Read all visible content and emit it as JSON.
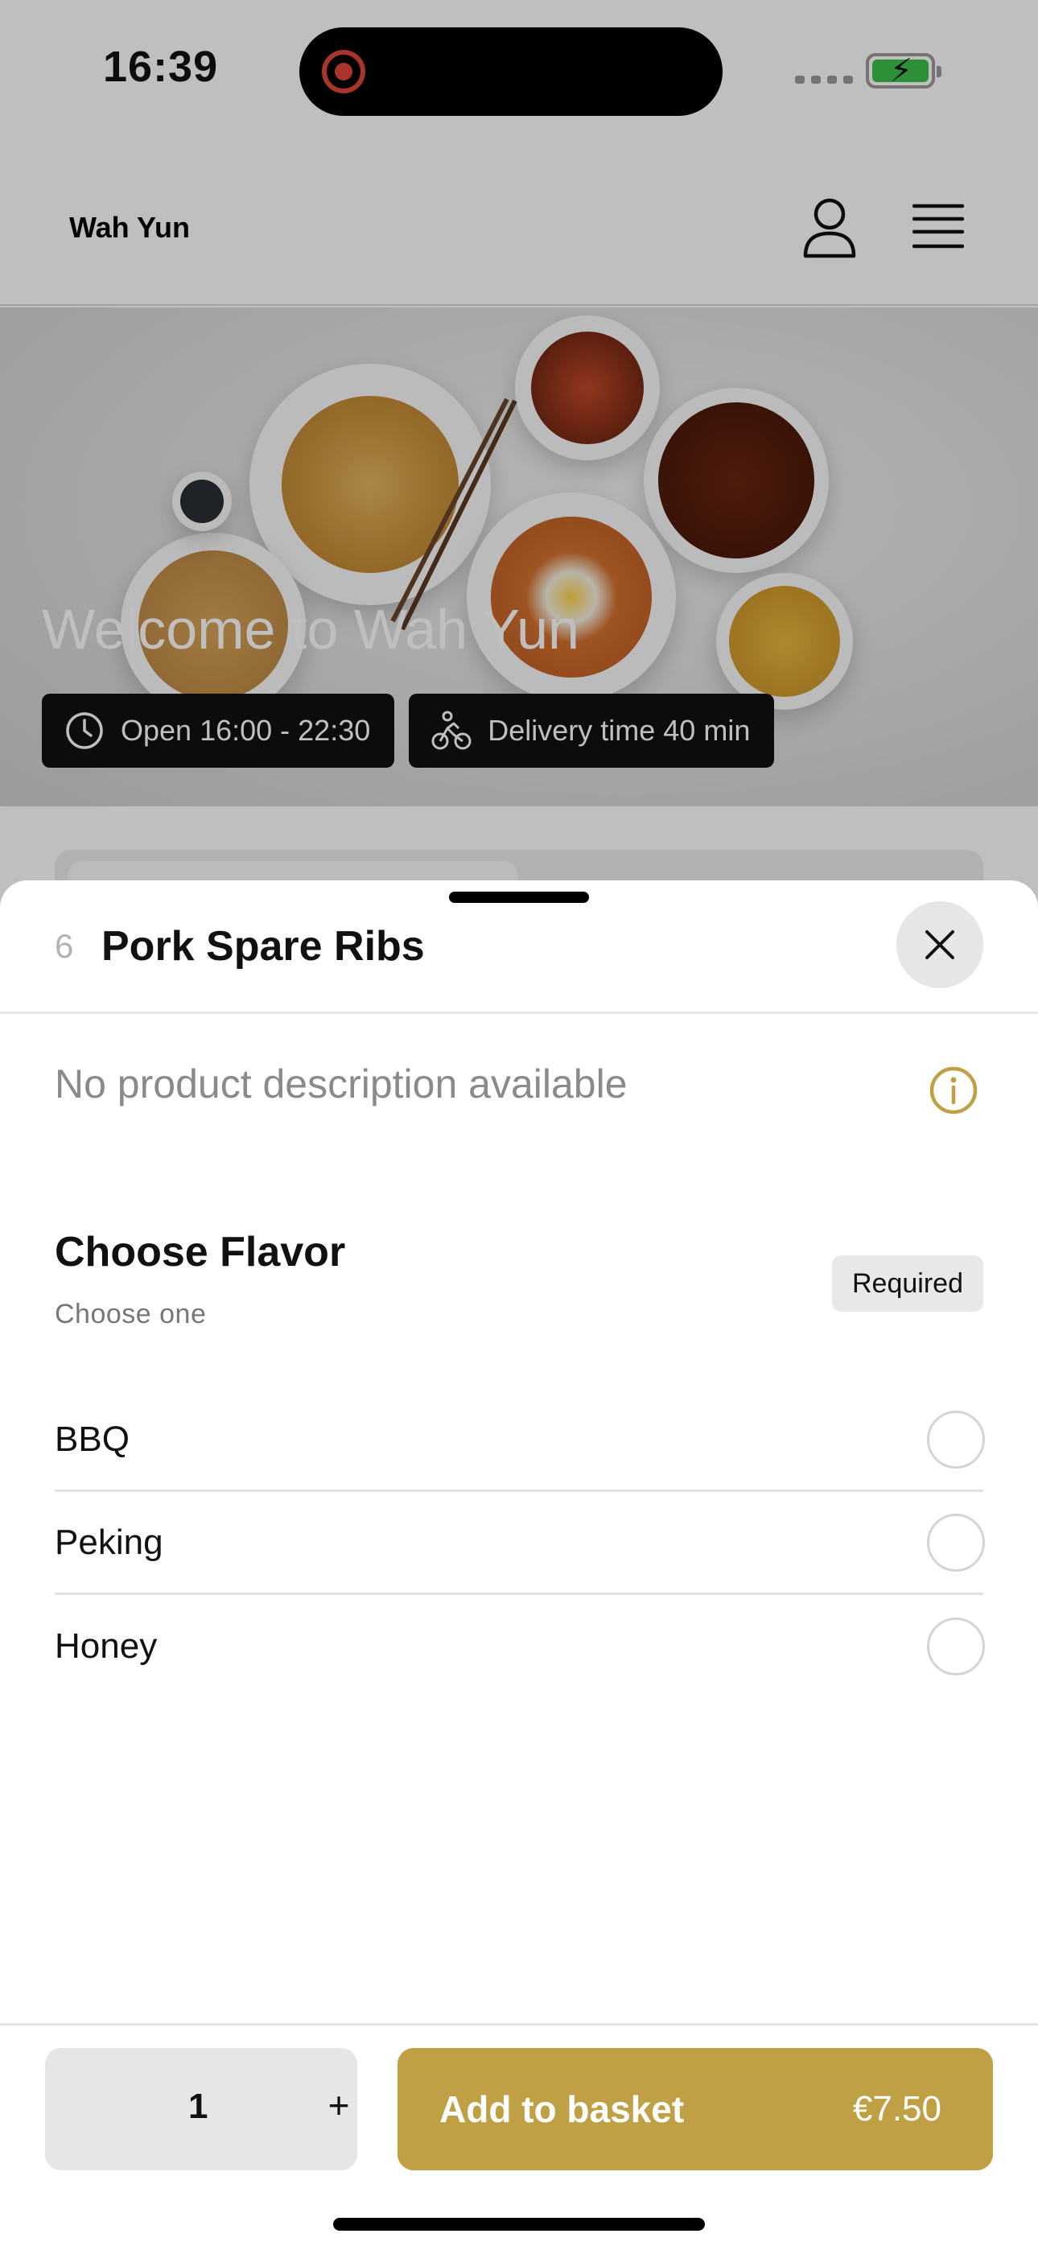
{
  "status_bar": {
    "time": "16:39"
  },
  "header": {
    "brand": "Wah Yun"
  },
  "hero": {
    "title": "Welcome to Wah Yun",
    "open_hours": "Open 16:00 - 22:30",
    "delivery_time": "Delivery time 40 min"
  },
  "product": {
    "number": "6",
    "title": "Pork Spare Ribs",
    "description": "No product description available"
  },
  "option_group": {
    "title": "Choose Flavor",
    "subtitle": "Choose one",
    "badge": "Required",
    "options": [
      {
        "label": "BBQ",
        "selected": false
      },
      {
        "label": "Peking",
        "selected": false
      },
      {
        "label": "Honey",
        "selected": false
      }
    ]
  },
  "footer": {
    "quantity": "1",
    "plus": "+",
    "add_label": "Add to basket",
    "price": "€7.50"
  },
  "colors": {
    "accent": "#bfa044",
    "chip_bg": "#111111",
    "record": "#e0463b",
    "battery": "#3cc14d"
  },
  "icons": [
    "user-icon",
    "menu-icon",
    "clock-icon",
    "bike-icon",
    "close-icon",
    "info-icon",
    "record-icon",
    "battery-icon"
  ]
}
